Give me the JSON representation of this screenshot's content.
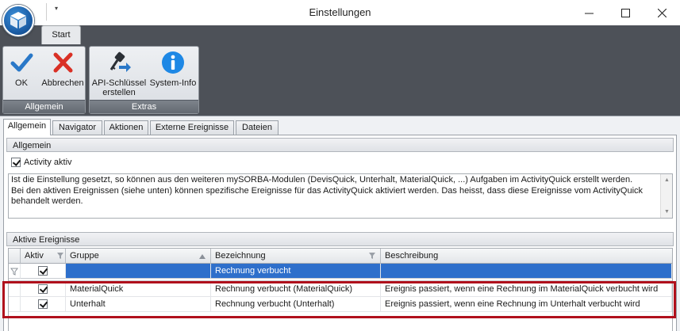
{
  "window": {
    "title": "Einstellungen",
    "minimize": "—",
    "maximize": "☐",
    "close": "✕"
  },
  "quick_access": {
    "customize_glyph": "▾"
  },
  "ribbon": {
    "tab": "Start",
    "groups": [
      {
        "caption": "Allgemein",
        "buttons": [
          {
            "label": "OK",
            "icon": "checkmark-icon"
          },
          {
            "label": "Abbrechen",
            "icon": "cancel-x-icon"
          }
        ]
      },
      {
        "caption": "Extras",
        "buttons": [
          {
            "label_line1": "API-Schlüssel",
            "label_line2": "erstellen",
            "icon": "key-icon"
          },
          {
            "label": "System-Info",
            "icon": "info-icon"
          }
        ]
      }
    ]
  },
  "tabs": [
    "Allgemein",
    "Navigator",
    "Aktionen",
    "Externe Ereignisse",
    "Dateien"
  ],
  "allgemein": {
    "header": "Allgemein",
    "activity_label": "Activity aktiv",
    "activity_checked": true,
    "description_line1": "Ist die Einstellung gesetzt, so können aus den weiteren mySORBA-Modulen (DevisQuick, Unterhalt, MaterialQuick, ...) Aufgaben im ActivityQuick erstellt werden.",
    "description_line2": "Bei den aktiven Ereignissen (siehe unten) können spezifische Ereignisse für das ActivityQuick aktiviert werden. Das heisst, dass diese Ereignisse vom ActivityQuick",
    "description_line3": "behandelt werden."
  },
  "ereignisse": {
    "header": "Aktive Ereignisse",
    "columns": [
      "Aktiv",
      "Gruppe",
      "Bezeichnung",
      "Beschreibung"
    ],
    "filter_row": {
      "aktiv": true,
      "gruppe": "",
      "bezeichnung": "Rechnung verbucht",
      "beschreibung": ""
    },
    "rows": [
      {
        "aktiv": true,
        "gruppe": "MaterialQuick",
        "bezeichnung": "Rechnung verbucht (MaterialQuick)",
        "beschreibung": "Ereignis passiert, wenn eine Rechnung im MaterialQuick verbucht wird"
      },
      {
        "aktiv": true,
        "gruppe": "Unterhalt",
        "bezeichnung": "Rechnung verbucht (Unterhalt)",
        "beschreibung": "Ereignis passiert, wenn eine Rechnung im Unterhalt verbucht wird"
      }
    ]
  },
  "colors": {
    "accent_selection": "#2e6fcb",
    "ribbon_dark": "#4d5158",
    "highlight_border": "#b0101c",
    "ok_check": "#2a78c8",
    "cancel_x": "#d93025",
    "info_blue": "#1e88e5"
  }
}
